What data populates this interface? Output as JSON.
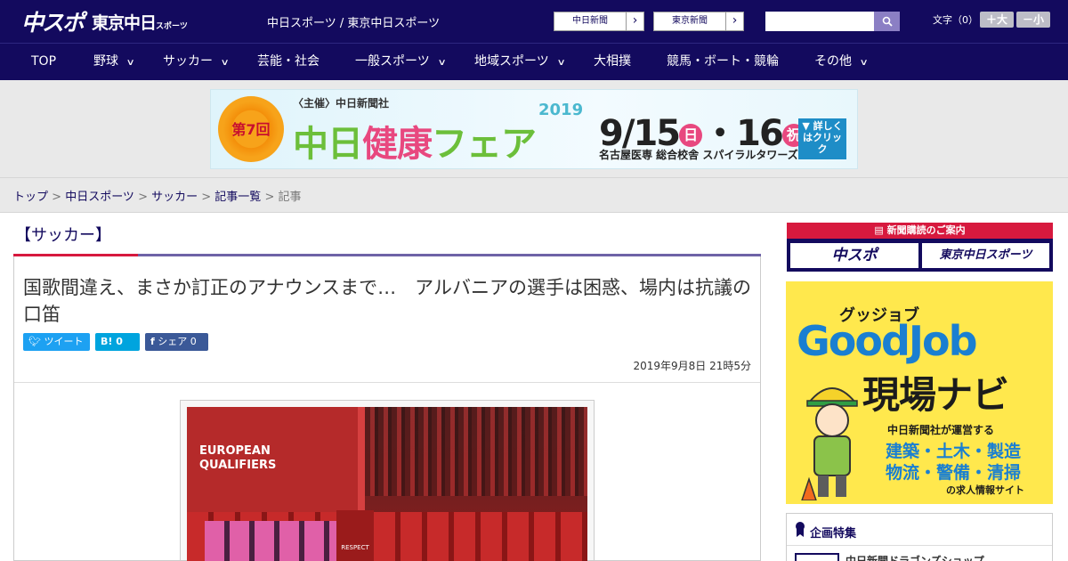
{
  "header": {
    "logo_main": "中スポ",
    "logo_sub": "東京中日",
    "logo_sub_small": "スポーツ",
    "site_title": "中日スポーツ / 東京中日スポーツ",
    "papers": [
      {
        "label": "中日新聞"
      },
      {
        "label": "東京新聞"
      }
    ],
    "search_placeholder": "",
    "fontsize_label": "文字（0）",
    "font_larger": "＋大",
    "font_smaller": "－小"
  },
  "nav": {
    "items": [
      {
        "label": "TOP",
        "has_menu": false
      },
      {
        "label": "野球",
        "has_menu": true
      },
      {
        "label": "サッカー",
        "has_menu": true
      },
      {
        "label": "芸能・社会",
        "has_menu": false
      },
      {
        "label": "一般スポーツ",
        "has_menu": true
      },
      {
        "label": "地域スポーツ",
        "has_menu": true
      },
      {
        "label": "大相撲",
        "has_menu": false
      },
      {
        "label": "競馬・ボート・競輪",
        "has_menu": false
      },
      {
        "label": "その他",
        "has_menu": true
      }
    ]
  },
  "banner": {
    "badge": "第7回",
    "organizer": "〈主催〉中日新聞社",
    "year": "2019",
    "title_a": "中日",
    "title_b": "健康",
    "title_c": "フェア",
    "date_a": "9/15",
    "day_a": "日",
    "date_b": "・16",
    "day_b": "祝",
    "venue": "名古屋医専 総合校舎 スパイラルタワーズ",
    "cta": "▼ 詳しくはクリック"
  },
  "breadcrumb": {
    "items": [
      "トップ",
      "中日スポーツ",
      "サッカー",
      "記事一覧"
    ],
    "current": "記事",
    "separator": " > "
  },
  "article": {
    "section": "【サッカー】",
    "headline": "国歌間違え、まさか訂正のアナウンスまで…　アルバニアの選手は困惑、場内は抗議の口笛",
    "share": {
      "tweet": "ツイート",
      "hatena": "B! 0",
      "facebook": "シェア 0"
    },
    "date": "2019年9月8日 21時5分",
    "photo_text": "EUROPEAN QUALIFIERS",
    "photo_badge": "RESPECT"
  },
  "sidebar": {
    "subscribe_head": "新聞購読のご案内",
    "subscribe_buttons": [
      "中スポ",
      "東京中日スポーツ"
    ],
    "goodjob": {
      "kana": "グッジョブ",
      "logo": "GoodJob",
      "navi": "現場ナビ",
      "sub": "中日新聞社が運営する",
      "jobs1": "建築・土木・製造",
      "jobs2": "物流・警備・清掃",
      "foot": "の求人情報サイト"
    },
    "feature_title": "企画特集",
    "feature_item": "中日新聞ドラゴンズショップ"
  },
  "colors": {
    "brand": "#130a5e",
    "accent_red": "#d7193e",
    "twitter": "#1da1f2",
    "hatena": "#00a4de",
    "facebook": "#3b5998"
  }
}
